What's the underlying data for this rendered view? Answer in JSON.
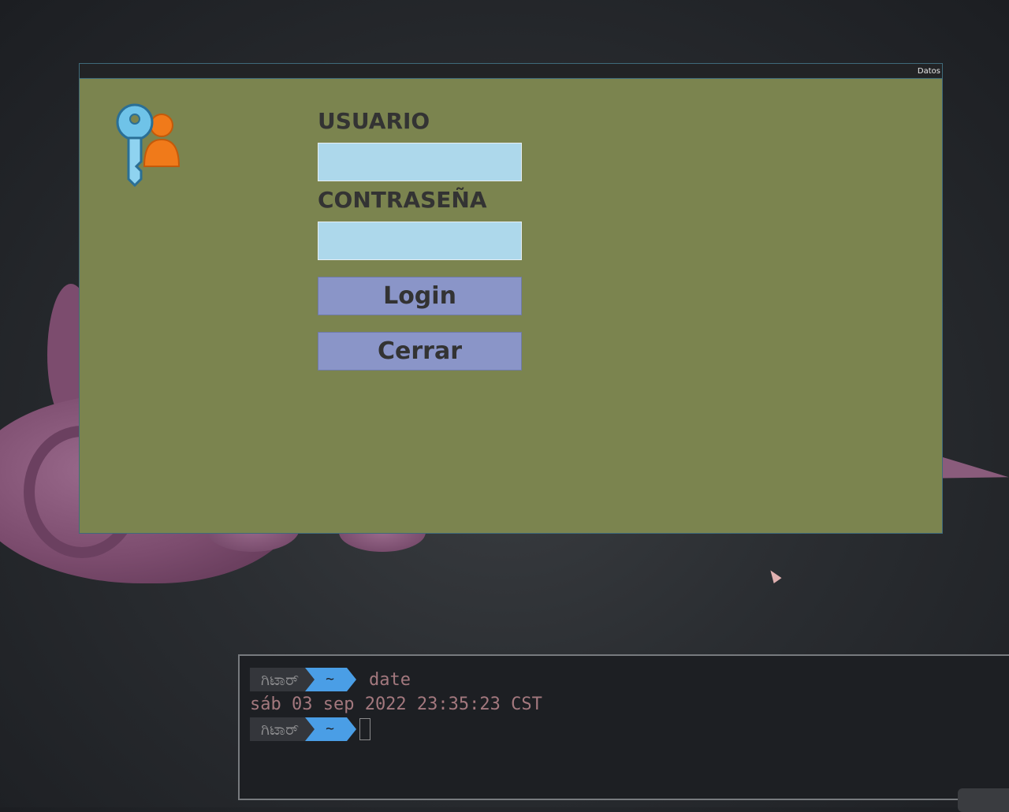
{
  "window": {
    "title": "Datos",
    "usuario_label": "USUARIO",
    "usuario_value": "",
    "contrasena_label": "CONTRASEÑA",
    "contrasena_value": "",
    "login_label": "Login",
    "cerrar_label": "Cerrar",
    "logo_icon": "key-user-icon"
  },
  "terminal": {
    "prompt_user": "ಗಿಟಾರ್",
    "prompt_dir": "~",
    "command": "date",
    "output": "sáb 03 sep 2022 23:35:23 CST"
  },
  "colors": {
    "window_bg": "#7b844f",
    "input_bg": "#add8eb",
    "button_bg": "#8a95c8",
    "prompt_dir_bg": "#4a9ee6"
  }
}
